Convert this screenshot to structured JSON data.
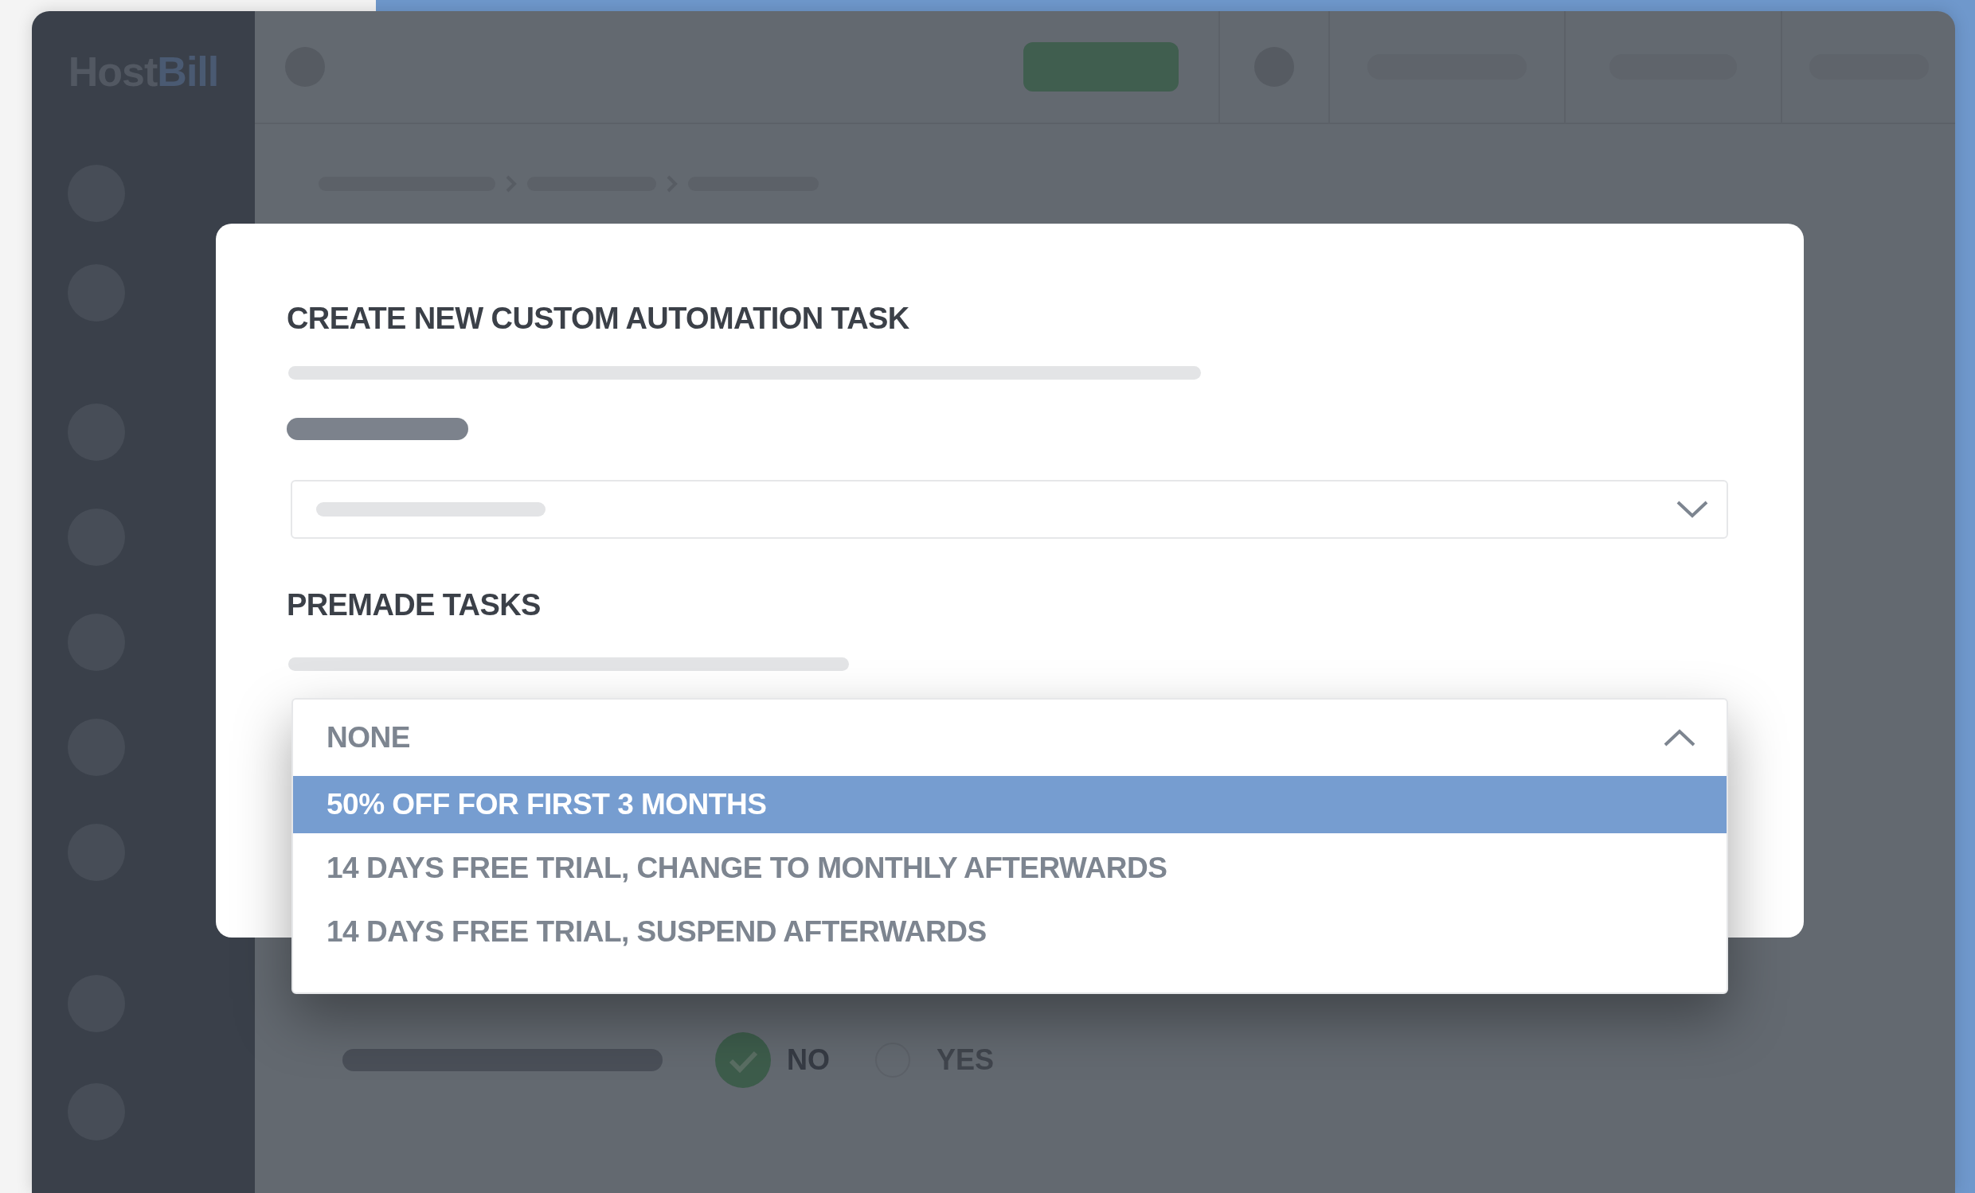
{
  "sidebar": {
    "logo": {
      "part_1": "Host",
      "part_2": "Bill"
    }
  },
  "modal": {
    "title": "CREATE NEW CUSTOM AUTOMATION TASK",
    "section_title": "PREMADE TASKS",
    "premade_dropdown": {
      "expanded": true,
      "value": "NONE",
      "options": [
        {
          "label": "50% OFF FOR FIRST 3 MONTHS",
          "selected": true
        },
        {
          "label": "14 DAYS FREE TRIAL, CHANGE TO MONTHLY AFTERWARDS",
          "selected": false
        },
        {
          "label": "14 DAYS FREE TRIAL, SUSPEND AFTERWARDS",
          "selected": false
        }
      ]
    }
  },
  "background_form": {
    "radios": [
      {
        "label": "NO",
        "selected": true
      },
      {
        "label": "YES",
        "selected": false
      }
    ]
  }
}
